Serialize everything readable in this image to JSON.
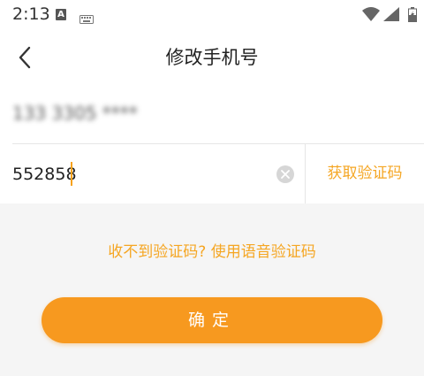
{
  "status_bar": {
    "time": "2:13",
    "notification_letter": "A",
    "icons": [
      "keyboard-icon",
      "wifi-icon",
      "signal-icon",
      "battery-charging-icon"
    ]
  },
  "header": {
    "title": "修改手机号",
    "back_icon": "chevron-left-icon"
  },
  "form": {
    "phone_value": "133 3305 ****",
    "code_value": "552858",
    "clear_icon": "clear-icon",
    "get_code_label": "获取验证码"
  },
  "voice_code_label": "收不到验证码? 使用语音验证码",
  "confirm_label": "确定",
  "colors": {
    "accent": "#f5a623",
    "button": "#f7991f",
    "background": "#f5f5f5"
  }
}
